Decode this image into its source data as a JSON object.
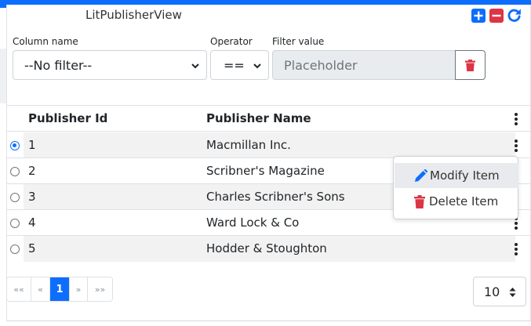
{
  "title": "LitPublisherView",
  "colors": {
    "accent": "#0d6efd",
    "danger": "#dc3545"
  },
  "toolbar": {
    "add_icon": "plus-square-icon",
    "remove_icon": "minus-square-icon",
    "refresh_icon": "refresh-icon"
  },
  "filter": {
    "column_label": "Column name",
    "column_value": "--No filter--",
    "operator_label": "Operator",
    "operator_value": "==",
    "value_label": "Filter value",
    "value_placeholder": "Placeholder",
    "clear_icon": "trash-icon"
  },
  "table": {
    "columns": [
      "Publisher Id",
      "Publisher Name"
    ],
    "rows": [
      {
        "id": "1",
        "name": "Macmillan Inc.",
        "selected": true
      },
      {
        "id": "2",
        "name": "Scribner's Magazine",
        "selected": false
      },
      {
        "id": "3",
        "name": "Charles Scribner's Sons",
        "selected": false
      },
      {
        "id": "4",
        "name": "Ward Lock & Co",
        "selected": false
      },
      {
        "id": "5",
        "name": "Hodder & Stoughton",
        "selected": false
      }
    ]
  },
  "context_menu": {
    "items": [
      {
        "label": "Modify Item",
        "icon": "pencil-icon"
      },
      {
        "label": "Delete Item",
        "icon": "trash-icon"
      }
    ]
  },
  "pagination": {
    "first": "««",
    "prev": "«",
    "current": "1",
    "next": "»",
    "last": "»»"
  },
  "page_size": {
    "value": "10"
  }
}
